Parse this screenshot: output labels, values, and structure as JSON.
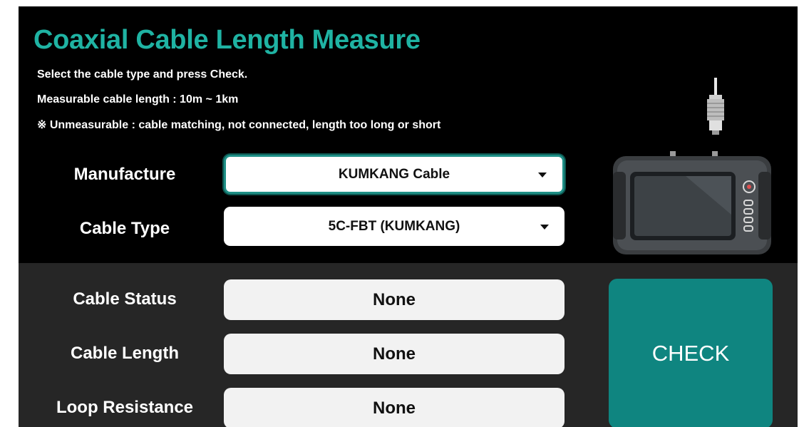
{
  "title": "Coaxial Cable Length Measure",
  "instructions": {
    "line1": "Select the cable type and press Check.",
    "line2": "Measurable cable length : 10m ~ 1km",
    "line3": "※ Unmeasurable : cable matching, not connected, length too long or short"
  },
  "form": {
    "manufacture_label": "Manufacture",
    "manufacture_value": "KUMKANG Cable",
    "cable_type_label": "Cable Type",
    "cable_type_value": "5C-FBT (KUMKANG)"
  },
  "results": {
    "status_label": "Cable Status",
    "status_value": "None",
    "length_label": "Cable Length",
    "length_value": "None",
    "loop_label": "Loop Resistance",
    "loop_value": "None"
  },
  "check_label": "CHECK",
  "colors": {
    "accent": "#1fb3a3",
    "button": "#0f8580",
    "lower_panel": "#262626"
  },
  "icons": {
    "device": "tester-device-illustration",
    "connector": "bnc-connector-icon",
    "dropdown": "caret-down-icon"
  }
}
